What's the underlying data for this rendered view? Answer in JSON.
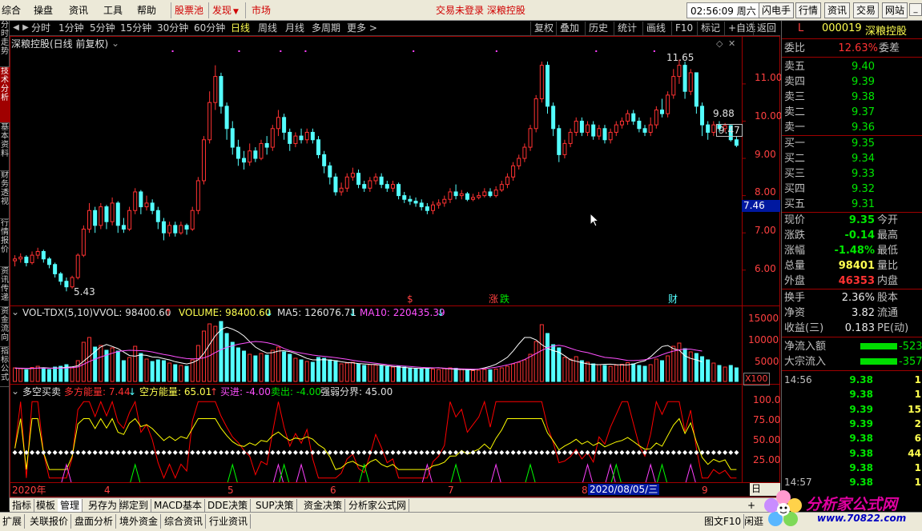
{
  "menu": {
    "items": [
      "综合",
      "操盘",
      "资讯",
      "工具",
      "帮助"
    ],
    "red_items": [
      "股票池",
      "发现",
      "市场"
    ],
    "status": "交易未登录  深粮控股",
    "clock": "02:56:09 周六",
    "right_buttons": [
      "闪电手",
      "行情",
      "资讯",
      "交易",
      "网站"
    ]
  },
  "left_tabs": [
    "分时走势",
    "技术分析",
    "基本资料",
    "财务透视",
    "行情报价",
    "资讯传递",
    "资金流向",
    "指标公式"
  ],
  "periods": {
    "items": [
      "分时",
      "1分钟",
      "5分钟",
      "15分钟",
      "30分钟",
      "60分钟",
      "日线",
      "周线",
      "月线",
      "多周期",
      "更多 >"
    ],
    "active": "日线",
    "tools": [
      "复权",
      "叠加",
      "历史",
      "统计",
      "画线",
      "F10",
      "标记",
      "+自选",
      "返回"
    ]
  },
  "chart_title": "深粮控股(日线 前复权)",
  "price_axis": [
    "11.00",
    "10.00",
    "9.00",
    "8.00",
    "7.00",
    "6.00"
  ],
  "cursor_price": "7.46",
  "annotations": {
    "high": "11.65",
    "low": "5.43",
    "right_high": "9.88",
    "right_last": "9.47",
    "event_s": "$",
    "event_rise": "涨",
    "event_fall": "跌",
    "event_fin": "财"
  },
  "volume_panel": {
    "name": "VOL-TDX(5,10)",
    "vvol": "VVOL: 98400.60",
    "volume": "VOLUME: 98400.60",
    "ma5": "MA5: 126076.71",
    "ma10": "MA10: 220435.39",
    "axis": [
      "15000",
      "10000",
      "5000"
    ],
    "unit": "X100"
  },
  "energy_panel": {
    "name": "多空买卖",
    "bull": "多方能量: 7.44",
    "bear": "空方能量: 65.01",
    "buy": "买进: -4.00",
    "sell": "卖出: -4.00",
    "threshold": "强弱分界: 45.00",
    "axis": [
      "100.0",
      "75.00",
      "50.00",
      "25.00"
    ]
  },
  "date_axis": {
    "labels": [
      "2020年",
      "4",
      "5",
      "6",
      "7",
      "8",
      "9"
    ],
    "cursor_date": "2020/08/05/三",
    "period_label": "日"
  },
  "quote": {
    "flag": "L",
    "code": "000019",
    "name": "深粮控股",
    "webi_label": "委比",
    "webi": "12.63%",
    "weicha_label": "委差",
    "asks": [
      {
        "label": "卖五",
        "price": "9.40"
      },
      {
        "label": "卖四",
        "price": "9.39"
      },
      {
        "label": "卖三",
        "price": "9.38"
      },
      {
        "label": "卖二",
        "price": "9.37"
      },
      {
        "label": "卖一",
        "price": "9.36"
      }
    ],
    "bids": [
      {
        "label": "买一",
        "price": "9.35"
      },
      {
        "label": "买二",
        "price": "9.34"
      },
      {
        "label": "买三",
        "price": "9.33"
      },
      {
        "label": "买四",
        "price": "9.32"
      },
      {
        "label": "买五",
        "price": "9.31"
      }
    ],
    "stats": [
      {
        "label": "现价",
        "value": "9.35",
        "label2": "今开",
        "color": "green"
      },
      {
        "label": "涨跌",
        "value": "-0.14",
        "label2": "最高",
        "color": "green"
      },
      {
        "label": "涨幅",
        "value": "-1.48%",
        "label2": "最低",
        "color": "green"
      },
      {
        "label": "总量",
        "value": "98401",
        "label2": "量比",
        "color": "yellow"
      },
      {
        "label": "外盘",
        "value": "46353",
        "label2": "内盘",
        "color": "red"
      }
    ],
    "stats2": [
      {
        "label": "换手",
        "value": "2.36%",
        "label2": "股本"
      },
      {
        "label": "净资",
        "value": "3.82",
        "label2": "流通"
      },
      {
        "label": "收益(三)",
        "value": "0.183",
        "label2": "PE(动)"
      }
    ],
    "flows": [
      {
        "label": "净流入额",
        "value": "-523."
      },
      {
        "label": "大宗流入",
        "value": "-357."
      }
    ],
    "ticks": [
      {
        "time": "14:56",
        "price": "9.38",
        "vol": "1"
      },
      {
        "time": "",
        "price": "9.38",
        "vol": "1"
      },
      {
        "time": "",
        "price": "9.39",
        "vol": "15"
      },
      {
        "time": "",
        "price": "9.39",
        "vol": "2"
      },
      {
        "time": "",
        "price": "9.38",
        "vol": "6"
      },
      {
        "time": "",
        "price": "9.38",
        "vol": "44"
      },
      {
        "time": "",
        "price": "9.38",
        "vol": "1"
      },
      {
        "time": "14:57",
        "price": "9.38",
        "vol": "1"
      }
    ]
  },
  "indicator_tabs": [
    "指标",
    "模板",
    "管理",
    "另存为",
    "绑定到",
    "MACD基本",
    "DDE决策",
    "SUP决策",
    "资金决策",
    "分析家公式网"
  ],
  "indicator_tab_active": "管理",
  "bottom_tabs": [
    "扩展",
    "关联报价",
    "盘面分析",
    "境外资金",
    "综合资讯",
    "行业资讯"
  ],
  "bottom_right": [
    "图文F10",
    "闲逛"
  ],
  "watermark": {
    "brand": "分析家公式网",
    "site": "www.70822.com"
  },
  "colors": {
    "up": "#ff3232",
    "down": "#54ffff",
    "ma5": "#ffffff",
    "ma10": "#ff50ff",
    "bull": "#ff0000",
    "bear": "#ffff00",
    "threshold": "#ffffff",
    "buy": "#ff40ff",
    "sell": "#00ff00"
  },
  "chart_data": {
    "type": "candlestick",
    "ylim": [
      5.2,
      11.9
    ],
    "volume_ylim": [
      0,
      16000
    ],
    "energy_ylim": [
      10,
      110
    ],
    "threshold": 45,
    "candles": [
      [
        6.25,
        6.3,
        6.4,
        6.1,
        3400
      ],
      [
        6.3,
        6.35,
        6.45,
        6.2,
        3200
      ],
      [
        6.35,
        6.2,
        6.4,
        6.1,
        2900
      ],
      [
        6.2,
        6.4,
        6.5,
        6.15,
        3500
      ],
      [
        6.4,
        6.5,
        6.6,
        6.3,
        3800
      ],
      [
        6.5,
        6.3,
        6.55,
        6.2,
        3300
      ],
      [
        6.3,
        6.15,
        6.35,
        6.05,
        3000
      ],
      [
        6.15,
        5.9,
        6.2,
        5.8,
        3600
      ],
      [
        5.9,
        5.7,
        5.95,
        5.6,
        3800
      ],
      [
        5.7,
        5.55,
        5.8,
        5.43,
        4200
      ],
      [
        5.55,
        5.8,
        5.85,
        5.5,
        3400
      ],
      [
        5.8,
        6.4,
        6.45,
        5.75,
        5200
      ],
      [
        6.4,
        7.1,
        7.2,
        6.35,
        9800
      ],
      [
        7.1,
        7.6,
        7.8,
        7.0,
        11000
      ],
      [
        7.6,
        7.2,
        7.7,
        7.0,
        8600
      ],
      [
        7.2,
        7.7,
        7.8,
        7.1,
        9000
      ],
      [
        7.7,
        7.3,
        7.75,
        7.1,
        7800
      ],
      [
        7.3,
        7.8,
        7.95,
        7.2,
        8400
      ],
      [
        7.8,
        7.2,
        7.85,
        7.0,
        7600
      ],
      [
        7.2,
        7.1,
        7.4,
        7.0,
        5200
      ],
      [
        7.1,
        7.6,
        7.7,
        7.05,
        6000
      ],
      [
        7.6,
        8.1,
        8.2,
        7.5,
        8800
      ],
      [
        8.1,
        7.7,
        8.15,
        7.5,
        7000
      ],
      [
        7.7,
        7.8,
        8.0,
        7.6,
        5600
      ],
      [
        7.8,
        7.6,
        7.9,
        7.5,
        5000
      ],
      [
        7.6,
        7.3,
        7.7,
        7.1,
        5400
      ],
      [
        7.3,
        7.0,
        7.4,
        6.8,
        5200
      ],
      [
        7.0,
        7.2,
        7.3,
        6.9,
        4600
      ],
      [
        7.2,
        7.0,
        7.3,
        6.9,
        4200
      ],
      [
        7.0,
        7.2,
        7.3,
        6.95,
        4000
      ],
      [
        7.2,
        7.1,
        7.25,
        6.95,
        3800
      ],
      [
        7.1,
        7.6,
        7.7,
        7.05,
        5400
      ],
      [
        7.6,
        8.4,
        8.5,
        7.5,
        9000
      ],
      [
        8.4,
        9.5,
        9.6,
        8.3,
        12600
      ],
      [
        9.5,
        10.5,
        10.8,
        9.4,
        14400
      ],
      [
        10.5,
        11.2,
        11.5,
        10.3,
        13800
      ],
      [
        11.2,
        10.4,
        11.3,
        10.2,
        15000
      ],
      [
        10.4,
        9.8,
        10.5,
        9.5,
        12000
      ],
      [
        9.8,
        9.3,
        10.0,
        9.1,
        9800
      ],
      [
        9.3,
        9.0,
        9.5,
        8.8,
        8400
      ],
      [
        9.0,
        8.9,
        9.2,
        8.7,
        7600
      ],
      [
        8.9,
        9.2,
        9.4,
        8.8,
        6800
      ],
      [
        9.2,
        9.0,
        9.3,
        8.9,
        6400
      ],
      [
        9.0,
        9.4,
        9.5,
        8.95,
        7000
      ],
      [
        9.4,
        9.3,
        9.6,
        9.1,
        6600
      ],
      [
        9.3,
        9.8,
        9.9,
        9.2,
        7800
      ],
      [
        9.8,
        10.1,
        10.3,
        9.6,
        8600
      ],
      [
        10.1,
        9.7,
        10.2,
        9.5,
        7400
      ],
      [
        9.7,
        9.4,
        9.8,
        9.2,
        6800
      ],
      [
        9.4,
        9.6,
        9.7,
        9.3,
        5800
      ],
      [
        9.6,
        9.5,
        9.8,
        9.4,
        5400
      ],
      [
        9.5,
        9.7,
        9.8,
        9.4,
        5000
      ],
      [
        9.7,
        9.5,
        9.8,
        9.4,
        4800
      ],
      [
        9.5,
        9.1,
        9.6,
        9.0,
        6000
      ],
      [
        9.1,
        8.8,
        9.2,
        8.6,
        5800
      ],
      [
        8.8,
        8.5,
        8.9,
        8.3,
        5400
      ],
      [
        8.5,
        8.1,
        8.6,
        8.0,
        5200
      ],
      [
        8.1,
        8.2,
        8.35,
        8.0,
        4400
      ],
      [
        8.2,
        8.5,
        8.6,
        8.1,
        4600
      ],
      [
        8.5,
        8.6,
        8.75,
        8.4,
        4800
      ],
      [
        8.6,
        8.3,
        8.7,
        8.2,
        4400
      ],
      [
        8.3,
        8.2,
        8.4,
        8.1,
        4000
      ],
      [
        8.2,
        8.4,
        8.5,
        8.1,
        4200
      ],
      [
        8.4,
        8.5,
        8.6,
        8.3,
        4100
      ],
      [
        8.5,
        8.3,
        8.6,
        8.2,
        3900
      ],
      [
        8.3,
        8.2,
        8.4,
        8.1,
        3700
      ],
      [
        8.2,
        8.3,
        8.4,
        8.1,
        3600
      ],
      [
        8.3,
        8.0,
        8.35,
        7.9,
        3800
      ],
      [
        8.0,
        7.9,
        8.1,
        7.8,
        3600
      ],
      [
        7.9,
        7.85,
        8.0,
        7.75,
        3400
      ],
      [
        7.85,
        7.8,
        7.95,
        7.7,
        3300
      ],
      [
        7.8,
        7.7,
        7.9,
        7.6,
        3200
      ],
      [
        7.7,
        7.6,
        7.8,
        7.5,
        3300
      ],
      [
        7.6,
        7.75,
        7.85,
        7.5,
        3100
      ],
      [
        7.75,
        7.8,
        7.9,
        7.65,
        3000
      ],
      [
        7.8,
        7.9,
        8.0,
        7.7,
        3200
      ],
      [
        7.9,
        8.1,
        8.2,
        7.8,
        3400
      ],
      [
        8.1,
        8.0,
        8.3,
        7.9,
        3300
      ],
      [
        8.0,
        8.05,
        8.15,
        7.9,
        3000
      ],
      [
        8.05,
        7.9,
        8.1,
        7.85,
        2900
      ],
      [
        7.9,
        7.95,
        8.05,
        7.85,
        2700
      ],
      [
        7.95,
        8.0,
        8.1,
        7.9,
        2800
      ],
      [
        8.0,
        8.1,
        8.2,
        7.95,
        3000
      ],
      [
        8.1,
        8.0,
        8.2,
        7.95,
        2900
      ],
      [
        8.0,
        8.15,
        8.25,
        7.95,
        3100
      ],
      [
        8.15,
        8.3,
        8.4,
        8.1,
        3400
      ],
      [
        8.3,
        8.5,
        8.6,
        8.2,
        3800
      ],
      [
        8.5,
        8.8,
        8.9,
        8.4,
        4400
      ],
      [
        8.8,
        9.0,
        9.1,
        8.7,
        4800
      ],
      [
        9.0,
        9.3,
        9.4,
        8.9,
        5400
      ],
      [
        9.3,
        9.8,
        9.9,
        9.2,
        6800
      ],
      [
        9.8,
        10.6,
        10.7,
        9.7,
        10000
      ],
      [
        10.6,
        11.5,
        11.6,
        10.5,
        14200
      ],
      [
        11.5,
        10.4,
        11.6,
        10.2,
        12000
      ],
      [
        10.4,
        9.8,
        10.5,
        9.6,
        9200
      ],
      [
        9.8,
        9.1,
        9.9,
        8.9,
        8400
      ],
      [
        9.1,
        9.4,
        9.5,
        9.0,
        6000
      ],
      [
        9.4,
        9.7,
        9.8,
        9.3,
        5600
      ],
      [
        9.7,
        10.0,
        10.1,
        9.6,
        6200
      ],
      [
        10.0,
        9.7,
        10.1,
        9.6,
        5200
      ],
      [
        9.7,
        9.9,
        10.0,
        9.6,
        4800
      ],
      [
        9.9,
        9.6,
        10.0,
        9.5,
        4400
      ],
      [
        9.6,
        9.8,
        9.9,
        9.5,
        4200
      ],
      [
        9.8,
        9.5,
        9.9,
        9.4,
        4000
      ],
      [
        9.5,
        9.7,
        9.8,
        9.4,
        3800
      ],
      [
        9.7,
        9.9,
        10.0,
        9.6,
        4100
      ],
      [
        9.9,
        10.0,
        10.1,
        9.8,
        4300
      ],
      [
        10.0,
        10.2,
        10.3,
        9.9,
        4700
      ],
      [
        10.2,
        10.0,
        10.3,
        9.9,
        4400
      ],
      [
        10.0,
        9.8,
        10.1,
        9.7,
        4000
      ],
      [
        9.8,
        9.7,
        9.9,
        9.6,
        3800
      ],
      [
        9.7,
        9.9,
        10.1,
        9.6,
        4200
      ],
      [
        9.9,
        10.3,
        10.4,
        9.8,
        5600
      ],
      [
        10.3,
        10.2,
        10.6,
        10.1,
        5200
      ],
      [
        10.2,
        10.7,
        10.8,
        10.1,
        6400
      ],
      [
        10.7,
        11.2,
        11.4,
        10.6,
        8800
      ],
      [
        11.2,
        11.5,
        11.65,
        11.0,
        9600
      ],
      [
        11.5,
        10.8,
        11.6,
        10.6,
        8200
      ],
      [
        10.8,
        11.3,
        11.4,
        10.7,
        7400
      ],
      [
        11.3,
        10.4,
        11.3,
        10.2,
        7000
      ],
      [
        10.4,
        9.9,
        10.5,
        9.6,
        6200
      ],
      [
        9.9,
        9.7,
        10.0,
        9.5,
        5400
      ],
      [
        9.7,
        9.9,
        10.0,
        9.6,
        4600
      ],
      [
        9.9,
        9.8,
        10.0,
        9.7,
        4000
      ],
      [
        9.8,
        9.88,
        9.95,
        9.7,
        3600
      ],
      [
        9.88,
        9.5,
        9.9,
        9.45,
        4000
      ],
      [
        9.5,
        9.35,
        9.6,
        9.3,
        3400
      ]
    ],
    "ma5": [
      3300,
      3280,
      3200,
      3260,
      3360,
      3460,
      3340,
      3320,
      3400,
      3560,
      3640,
      3920,
      5080,
      6240,
      7480,
      8640,
      9240,
      8760,
      8200,
      7360,
      6480,
      6320,
      6640,
      6520,
      6120,
      6040,
      5700,
      5400,
      4940,
      4660,
      4380,
      4700,
      5400,
      7000,
      9280,
      11420,
      12960,
      13560,
      13080,
      12400,
      11380,
      9960,
      8600,
      7760,
      7100,
      7200,
      7600,
      7700,
      7460,
      7000,
      6400,
      5760,
      5400,
      5400,
      5440,
      5340,
      5200,
      4920,
      4720,
      4640,
      4480,
      4380,
      4280,
      4220,
      4100,
      3920,
      3740,
      3620,
      3500,
      3380,
      3300,
      3260,
      3280,
      3380,
      3440,
      3260,
      3160,
      3030,
      2980,
      2950,
      2880,
      3100,
      3400,
      3780,
      4280,
      5140,
      6040,
      7620,
      9400,
      11000,
      11000,
      10400,
      9200,
      8280,
      7700,
      7320,
      6440,
      5400,
      5060,
      4700,
      4400,
      4260,
      4200,
      4300,
      4320,
      4200,
      4150,
      4160,
      4360,
      4820,
      5180,
      6160,
      7500,
      8740,
      9000,
      8180,
      7820,
      6380,
      5760,
      5400,
      4900
    ],
    "ma10": [
      3350,
      3330,
      3300,
      3300,
      3320,
      3330,
      3320,
      3310,
      3320,
      3390,
      3480,
      3600,
      4300,
      4980,
      5580,
      6120,
      6600,
      7060,
      7500,
      7680,
      7800,
      7750,
      7700,
      7600,
      7380,
      7060,
      6750,
      6520,
      6200,
      5950,
      5720,
      5650,
      5700,
      5900,
      6450,
      7250,
      7960,
      8540,
      8920,
      9300,
      9560,
      9800,
      10000,
      9900,
      9700,
      9380,
      8940,
      8240,
      7700,
      7380,
      7100,
      6860,
      6600,
      6420,
      6280,
      6120,
      5960,
      5740,
      5540,
      5300,
      5080,
      4900,
      4720,
      4560,
      4380,
      4200,
      4060,
      3940,
      3840,
      3740,
      3630,
      3530,
      3460,
      3430,
      3400,
      3330,
      3260,
      3200,
      3160,
      3120,
      3080,
      3100,
      3180,
      3360,
      3560,
      3820,
      4140,
      4500,
      4940,
      5480,
      6220,
      7000,
      7760,
      8420,
      8840,
      9040,
      8800,
      8300,
      7840,
      7480,
      7220,
      6800,
      6400,
      6020,
      5900,
      5760,
      5500,
      5250,
      5220,
      5300,
      5440,
      5700,
      6140,
      6700,
      7200,
      7600,
      7900,
      8100,
      8080,
      7820,
      7600
    ]
  }
}
